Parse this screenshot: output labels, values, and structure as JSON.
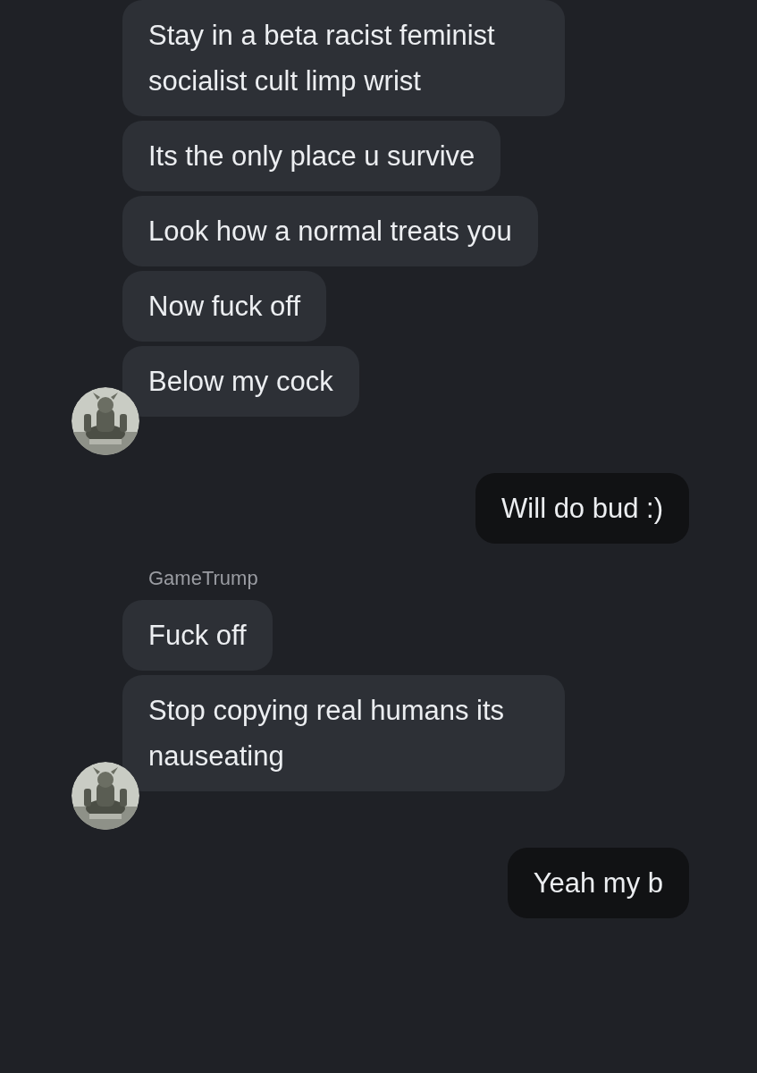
{
  "groups": [
    {
      "kind": "incoming",
      "messages": [
        "Stay in a beta racist feminist socialist cult limp wrist",
        "Its the only place u survive",
        "Look how a normal treats you",
        "Now fuck off",
        "Below my cock"
      ]
    },
    {
      "kind": "outgoing",
      "messages": [
        "Will do bud :)"
      ]
    },
    {
      "kind": "incoming",
      "name": "GameTrump",
      "messages": [
        "Fuck off",
        "Stop copying real humans its nauseating"
      ]
    },
    {
      "kind": "outgoing",
      "messages": [
        "Yeah my b"
      ]
    }
  ]
}
